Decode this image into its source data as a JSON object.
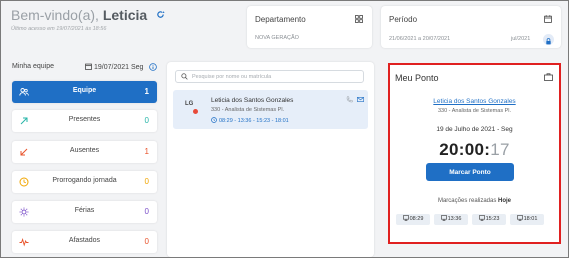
{
  "welcome": {
    "greeting": "Bem-vindo(a), ",
    "name": "Leticia",
    "last_access": "Último acesso em 19/07/2021 às 18:56"
  },
  "department": {
    "label": "Departamento",
    "value": "NOVA GERAÇÃO"
  },
  "period": {
    "label": "Período",
    "range": "21/06/2021 a 20/07/2021",
    "month": "jul/2021"
  },
  "team": {
    "label": "Minha equipe",
    "date": "19/07/2021 Seg",
    "items": [
      {
        "label": "Equipe",
        "count": "1",
        "icon": "people-icon",
        "color": "#ffffff"
      },
      {
        "label": "Presentes",
        "count": "0",
        "icon": "arrow-up-right-icon",
        "color": "#26b5a8"
      },
      {
        "label": "Ausentes",
        "count": "1",
        "icon": "arrow-down-left-icon",
        "color": "#e8532b"
      },
      {
        "label": "Prorrogando jornada",
        "count": "0",
        "icon": "clock-icon",
        "color": "#f1a500"
      },
      {
        "label": "Férias",
        "count": "0",
        "icon": "sun-icon",
        "color": "#7b4fc9"
      },
      {
        "label": "Afastados",
        "count": "0",
        "icon": "pulse-icon",
        "color": "#e8532b"
      }
    ]
  },
  "search": {
    "placeholder": "Pesquise por nome ou matrícula"
  },
  "employee": {
    "initials": "LG",
    "name": "Leticia dos Santos Gonzales",
    "role": "330 - Analista de Sistemas Pl.",
    "times": "08:29 - 13:36 - 15:23 - 18:01"
  },
  "ponto": {
    "title": "Meu Ponto",
    "name": "Leticia dos Santos Gonzales",
    "role": "330 - Analista de Sistemas Pl.",
    "date": "19 de Julho de 2021 - Seg",
    "clock_hm": "20:00:",
    "clock_s": "17",
    "button": "Marcar Ponto",
    "made_label": "Marcações realizadas",
    "made_day": "Hoje",
    "marks": [
      "08:29",
      "13:36",
      "15:23",
      "18:01"
    ]
  },
  "colors": {
    "primary": "#1f6fc5",
    "highlight_border": "#e02020"
  }
}
